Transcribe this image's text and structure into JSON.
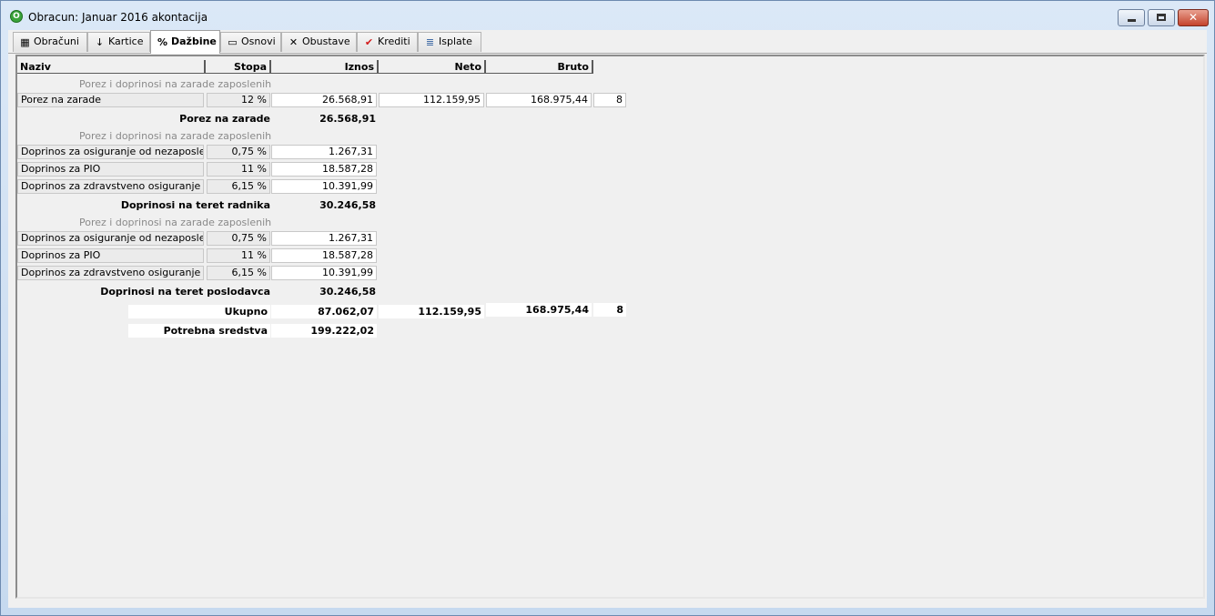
{
  "window": {
    "title": "Obracun: Januar 2016 akontacija",
    "app_icon_glyph": "O",
    "close_glyph": "✕"
  },
  "tabs": [
    {
      "label": "Obračuni",
      "icon": "calculator-icon",
      "glyph": "▦"
    },
    {
      "label": "Kartice",
      "icon": "sort-az-icon",
      "glyph": "↓"
    },
    {
      "label": "Dažbine",
      "icon": "percent-icon",
      "glyph": "%"
    },
    {
      "label": "Osnovi",
      "icon": "folder-icon",
      "glyph": "▭"
    },
    {
      "label": "Obustave",
      "icon": "cross-icon",
      "glyph": "✕"
    },
    {
      "label": "Krediti",
      "icon": "checkmark-icon",
      "glyph": "✔"
    },
    {
      "label": "Isplate",
      "icon": "list-icon",
      "glyph": "≣"
    }
  ],
  "columns": {
    "naziv": "Naziv",
    "stopa": "Stopa",
    "iznos": "Iznos",
    "neto": "Neto",
    "bruto": "Bruto"
  },
  "section_label": "Porez i doprinosi na zarade zaposlenih",
  "porez": {
    "row": {
      "naziv": "Porez na zarade",
      "stopa": "12 %",
      "iznos": "26.568,91",
      "neto": "112.159,95",
      "bruto": "168.975,44",
      "broj": "8"
    },
    "subtotal_label": "Porez na zarade",
    "subtotal_value": "26.568,91"
  },
  "radnik": {
    "rows": [
      {
        "naziv": "Doprinos za osiguranje od nezaposlenosti",
        "stopa": "0,75 %",
        "iznos": "1.267,31"
      },
      {
        "naziv": "Doprinos za PIO",
        "stopa": "11 %",
        "iznos": "18.587,28"
      },
      {
        "naziv": "Doprinos za zdravstveno osiguranje",
        "stopa": "6,15 %",
        "iznos": "10.391,99"
      }
    ],
    "subtotal_label": "Doprinosi na teret radnika",
    "subtotal_value": "30.246,58"
  },
  "poslodavac": {
    "rows": [
      {
        "naziv": "Doprinos za osiguranje od nezaposlenosti",
        "stopa": "0,75 %",
        "iznos": "1.267,31"
      },
      {
        "naziv": "Doprinos za PIO",
        "stopa": "11 %",
        "iznos": "18.587,28"
      },
      {
        "naziv": "Doprinos za zdravstveno osiguranje",
        "stopa": "6,15 %",
        "iznos": "10.391,99"
      }
    ],
    "subtotal_label": "Doprinosi na teret poslodavca",
    "subtotal_value": "30.246,58"
  },
  "ukupno": {
    "label": "Ukupno",
    "iznos": "87.062,07",
    "neto": "112.159,95",
    "bruto": "168.975,44",
    "broj": "8"
  },
  "potrebna": {
    "label": "Potrebna sredstva",
    "value": "199.222,02"
  }
}
